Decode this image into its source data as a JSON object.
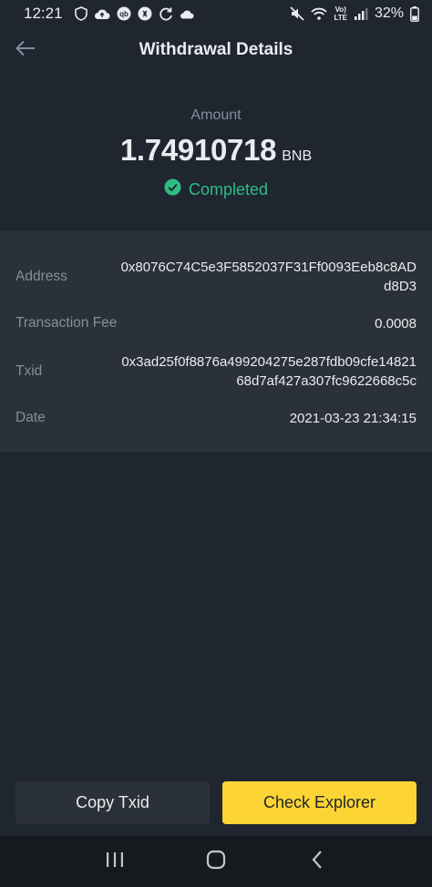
{
  "status_bar": {
    "time": "12:21",
    "lte_top": "Vo)",
    "lte_bottom": "LTE",
    "battery": "32%"
  },
  "header": {
    "title": "Withdrawal Details",
    "back_icon": "arrow-left-icon"
  },
  "summary": {
    "amount_label": "Amount",
    "amount_value": "1.74910718",
    "amount_unit": "BNB",
    "status": "Completed",
    "status_color": "#2ebd85"
  },
  "details": {
    "address": {
      "label": "Address",
      "value": "0x8076C74C5e3F5852037F31Ff0093Eeb8c8ADd8D3"
    },
    "fee": {
      "label": "Transaction Fee",
      "value": "0.0008"
    },
    "txid": {
      "label": "Txid",
      "value": "0x3ad25f0f8876a499204275e287fdb09cfe1482168d7af427a307fc9622668c5c"
    },
    "date": {
      "label": "Date",
      "value": "2021-03-23 21:34:15"
    }
  },
  "actions": {
    "copy_txid": "Copy Txid",
    "check_explorer": "Check Explorer",
    "accent": "#fcd535"
  }
}
